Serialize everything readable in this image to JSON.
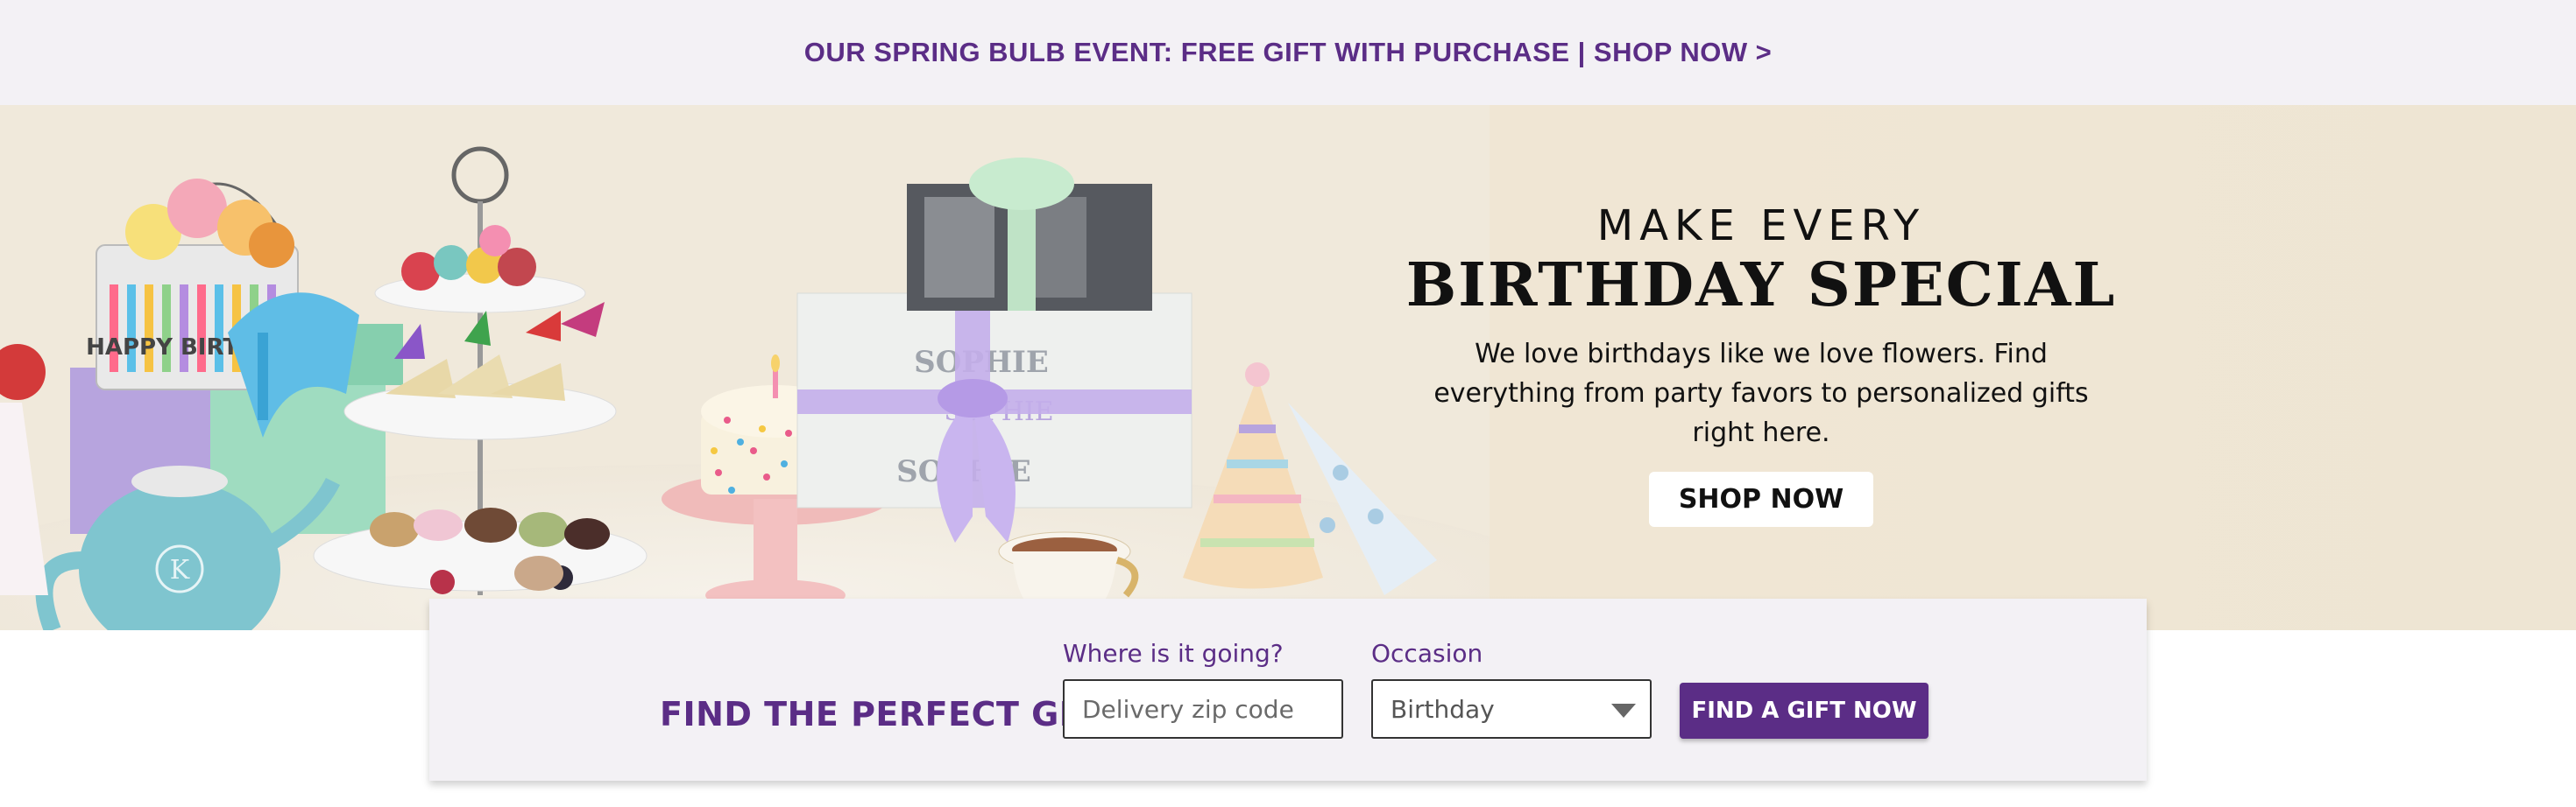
{
  "promo": {
    "text": "OUR SPRING BULB EVENT: FREE GIFT WITH PURCHASE | SHOP NOW >",
    "color": "#5b2d86"
  },
  "hero": {
    "kicker": "MAKE EVERY",
    "title": "BIRTHDAY SPECIAL",
    "description": "We love birthdays like we love flowers. Find everything from party favors to personalized gifts right here.",
    "cta_label": "SHOP NOW",
    "scene": {
      "gift_box_text": "SOPHIE",
      "tin_text": "HAPPY BIRTHDAY",
      "teapot_monogram": "K"
    }
  },
  "gift_finder": {
    "title": "FIND THE PERFECT GIFT",
    "zip": {
      "label": "Where is it going?",
      "placeholder": "Delivery zip code",
      "value": ""
    },
    "occasion": {
      "label": "Occasion",
      "selected": "Birthday"
    },
    "submit_label": "FIND A GIFT NOW",
    "accent_color": "#5b2d86"
  }
}
